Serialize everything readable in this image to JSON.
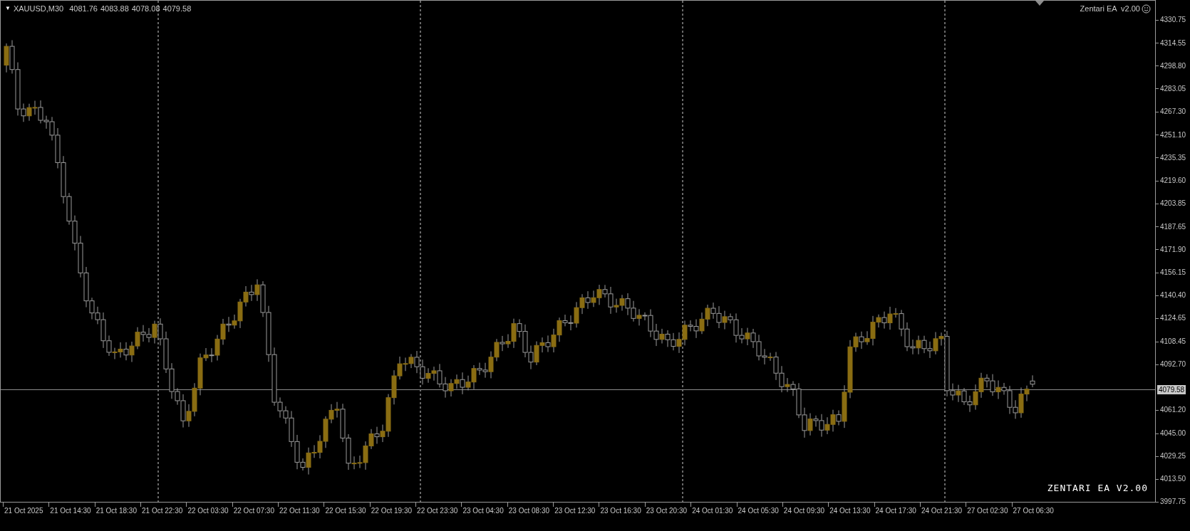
{
  "chart": {
    "header": {
      "menu_glyph": "▼",
      "symbol": "XAUUSD,M30",
      "ohlc": [
        "4081.76",
        "4083.88",
        "4078.08",
        "4079.58"
      ]
    },
    "expert_label": "Zentari EA  v2.00",
    "overlay_label": "ZENTARI EA V2.00",
    "current_price": "4079.58",
    "price_axis": [
      "4330.75",
      "4314.55",
      "4298.80",
      "4283.05",
      "4267.30",
      "4251.10",
      "4235.35",
      "4219.60",
      "4203.85",
      "4187.65",
      "4171.90",
      "4156.15",
      "4140.40",
      "4124.65",
      "4108.45",
      "4092.70",
      "4061.20",
      "4045.00",
      "4029.25",
      "4013.50",
      "3997.75"
    ],
    "time_axis": [
      "21 Oct 2025",
      "21 Oct 14:30",
      "21 Oct 18:30",
      "21 Oct 22:30",
      "22 Oct 03:30",
      "22 Oct 07:30",
      "22 Oct 11:30",
      "22 Oct 15:30",
      "22 Oct 19:30",
      "22 Oct 23:30",
      "23 Oct 04:30",
      "23 Oct 08:30",
      "23 Oct 12:30",
      "23 Oct 16:30",
      "23 Oct 20:30",
      "24 Oct 01:30",
      "24 Oct 05:30",
      "24 Oct 09:30",
      "24 Oct 13:30",
      "24 Oct 17:30",
      "24 Oct 21:30",
      "27 Oct 02:30",
      "27 Oct 06:30"
    ]
  }
}
